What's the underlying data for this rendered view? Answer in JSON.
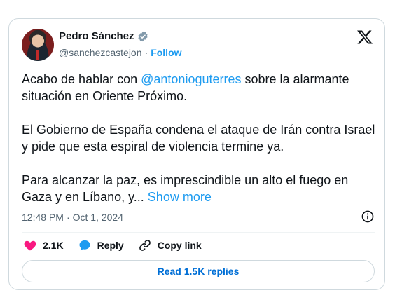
{
  "author": {
    "name": "Pedro Sánchez",
    "handle": "@sanchezcastejon",
    "separator": "·",
    "follow_label": "Follow"
  },
  "tweet": {
    "p1_before": "Acabo de hablar con ",
    "p1_mention": "@antonioguterres",
    "p1_after": " sobre la alarmante situación en Oriente Próximo.",
    "p2": "El Gobierno de España condena el ataque de Irán contra Israel y pide que esta espiral de violencia termine ya.",
    "p3": "Para alcanzar la paz, es imprescindible un alto el fuego en Gaza y en Líbano, y...",
    "show_more": "Show more"
  },
  "meta": {
    "time": "12:48 PM",
    "separator": "·",
    "date": "Oct 1, 2024"
  },
  "actions": {
    "likes": "2.1K",
    "reply_label": "Reply",
    "copy_link_label": "Copy link"
  },
  "replies_button": "Read 1.5K replies",
  "colors": {
    "accent": "#1d9bf0",
    "like": "#f91880",
    "reply_icon": "#1d9bf0",
    "border": "#cfd9de",
    "secondary_text": "#536471"
  },
  "icons": [
    "verified-badge-icon",
    "x-logo-icon",
    "info-icon",
    "heart-icon",
    "reply-bubble-icon",
    "link-icon"
  ]
}
